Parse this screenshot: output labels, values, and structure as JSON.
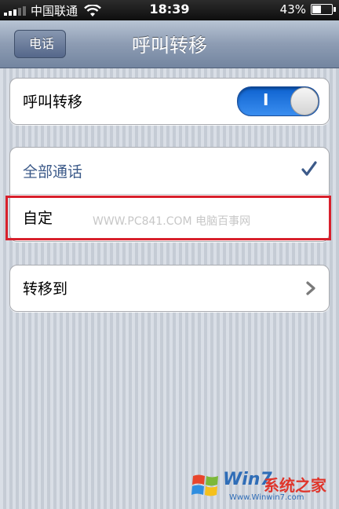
{
  "status_bar": {
    "carrier": "中国联通",
    "time": "18:39",
    "battery": "43%",
    "battery_level": 0.43
  },
  "nav": {
    "back_label": "电话",
    "title": "呼叫转移"
  },
  "forwarding": {
    "label": "呼叫转移",
    "toggle_on_text": "I",
    "enabled": true
  },
  "mode_options": [
    {
      "label": "全部通话",
      "selected": true
    },
    {
      "label": "自定",
      "selected": false
    }
  ],
  "forward_to": {
    "label": "转移到"
  },
  "watermark": "WWW.PC841.COM 电脑百事网",
  "logo": {
    "brand": "Win7",
    "cn_name": "系统之家",
    "url": "Www.Winwin7.com"
  },
  "colors": {
    "toggle_blue": "#1f74e0",
    "selected_text": "#3c5a89",
    "highlight_red": "#d8202c"
  }
}
